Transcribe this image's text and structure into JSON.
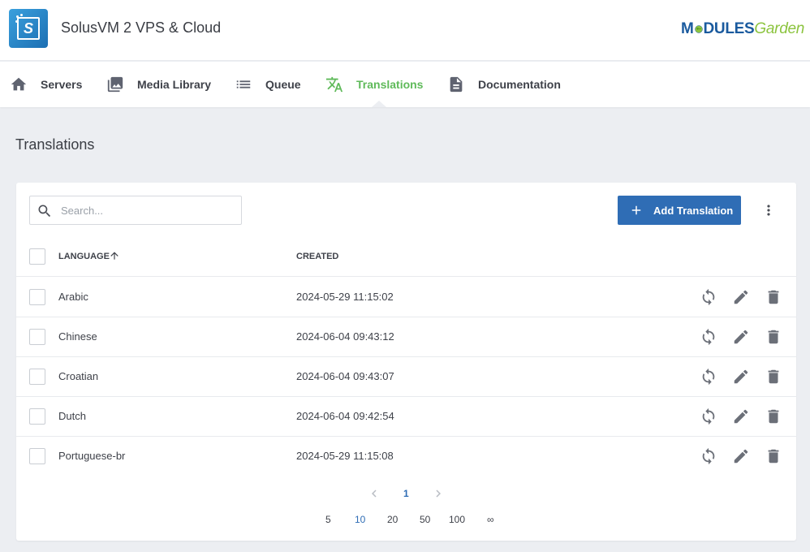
{
  "app": {
    "title": "SolusVM 2 VPS & Cloud"
  },
  "brand": {
    "left": "M",
    "middle": "DULES",
    "right": "Garden"
  },
  "nav": {
    "items": [
      {
        "label": "Servers",
        "icon": "home-icon",
        "active": false
      },
      {
        "label": "Media Library",
        "icon": "image-library-icon",
        "active": false
      },
      {
        "label": "Queue",
        "icon": "list-icon",
        "active": false
      },
      {
        "label": "Translations",
        "icon": "translate-icon",
        "active": true
      },
      {
        "label": "Documentation",
        "icon": "document-icon",
        "active": false
      }
    ]
  },
  "page": {
    "title": "Translations"
  },
  "toolbar": {
    "search_placeholder": "Search...",
    "add_label": "Add Translation"
  },
  "table": {
    "columns": [
      "LANGUAGE",
      "CREATED"
    ],
    "sort": {
      "column": "LANGUAGE",
      "direction": "ascending"
    },
    "rows": [
      {
        "language": "Arabic",
        "created": "2024-05-29 11:15:02"
      },
      {
        "language": "Chinese",
        "created": "2024-06-04 09:43:12"
      },
      {
        "language": "Croatian",
        "created": "2024-06-04 09:43:07"
      },
      {
        "language": "Dutch",
        "created": "2024-06-04 09:42:54"
      },
      {
        "language": "Portuguese-br",
        "created": "2024-05-29 11:15:08"
      }
    ]
  },
  "pagination": {
    "current_page": "1",
    "page_sizes": [
      "5",
      "10",
      "20",
      "50",
      "100",
      "∞"
    ],
    "selected_size": "10"
  },
  "colors": {
    "accent_green": "#5fba5a",
    "primary_blue": "#2f6db5",
    "background": "#eceef2"
  }
}
